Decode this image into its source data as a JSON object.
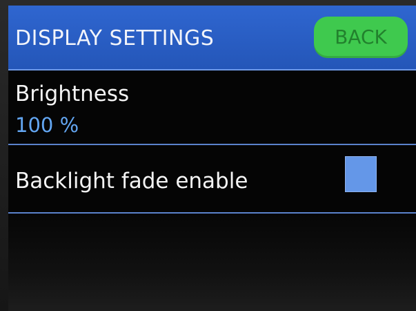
{
  "header": {
    "title": "DISPLAY SETTINGS",
    "back_label": "BACK",
    "back_color": "#3fc94e"
  },
  "settings": {
    "brightness": {
      "label": "Brightness",
      "value": "100 %"
    },
    "backlight_fade": {
      "label": "Backlight fade enable",
      "checked": false
    }
  },
  "colors": {
    "header_bg": "#2f66d0",
    "value_text": "#63a6f2",
    "checkbox": "#6497e8",
    "divider": "#5a82cc"
  }
}
